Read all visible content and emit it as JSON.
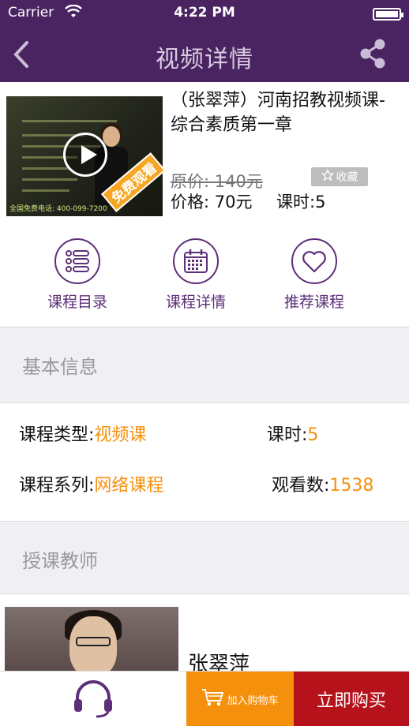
{
  "status": {
    "carrier": "Carrier",
    "time": "4:22 PM"
  },
  "nav": {
    "title": "视频详情"
  },
  "course": {
    "title": "（张翠萍）河南招教视频课-综合素质第一章",
    "free_badge": "免费观看",
    "phone_text": "全国免费电话: 400-099-7200",
    "original_price": "原价: 140元",
    "favorite": "收藏",
    "price": "价格: 70元",
    "hours": "课时:5"
  },
  "actions": [
    {
      "label": "课程目录",
      "icon": "list-icon"
    },
    {
      "label": "课程详情",
      "icon": "calendar-icon"
    },
    {
      "label": "推荐课程",
      "icon": "heart-icon"
    }
  ],
  "basic_info": {
    "section_title": "基本信息",
    "type_label": "课程类型:",
    "type_value": "视频课",
    "hours_label": "课时:",
    "hours_value": "5",
    "series_label": "课程系列:",
    "series_value": "网络课程",
    "views_label": "观看数:",
    "views_value": "1538"
  },
  "teacher": {
    "section_title": "授课教师",
    "name": "张翠萍"
  },
  "bottom": {
    "cart_label": "加入购物车",
    "buy_label": "立即购买"
  },
  "colors": {
    "header": "#4a2460",
    "accent": "#5c2f78",
    "orange": "#f5900d",
    "buy_red": "#b5121b"
  }
}
